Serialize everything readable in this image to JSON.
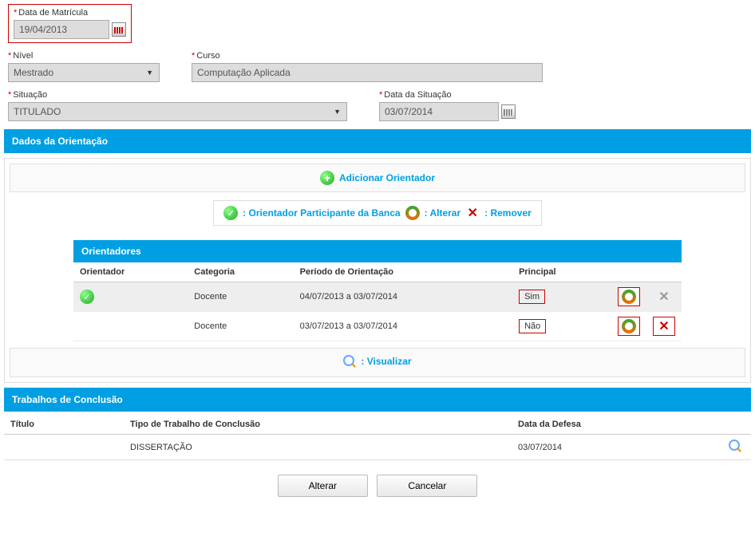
{
  "labels": {
    "matricula": "Data de Matrícula",
    "nivel": "Nível",
    "curso": "Curso",
    "situacao": "Situação",
    "data_situacao": "Data da Situação"
  },
  "values": {
    "matricula": "19/04/2013",
    "nivel": "Mestrado",
    "curso": "Computação Aplicada",
    "situacao": "TITULADO",
    "data_situacao": "03/07/2014"
  },
  "sections": {
    "orientacao": "Dados da Orientação",
    "orientadores": "Orientadores",
    "trabalhos": "Trabalhos de Conclusão"
  },
  "links": {
    "adicionar": "Adicionar Orientador",
    "visualizar": ": Visualizar"
  },
  "legend": {
    "participante": ": Orientador Participante da Banca",
    "alterar": ": Alterar",
    "remover": ": Remover"
  },
  "orientadores_table": {
    "headers": {
      "orientador": "Orientador",
      "categoria": "Categoria",
      "periodo": "Período de Orientação",
      "principal": "Principal"
    },
    "rows": [
      {
        "orientador": "",
        "check": true,
        "categoria": "Docente",
        "periodo": "04/07/2013 a 03/07/2014",
        "principal": "Sim",
        "remove_disabled": true
      },
      {
        "orientador": "",
        "check": false,
        "categoria": "Docente",
        "periodo": "03/07/2013 a 03/07/2014",
        "principal": "Não",
        "remove_disabled": false
      }
    ]
  },
  "trabalhos_table": {
    "headers": {
      "titulo": "Título",
      "tipo": "Tipo de Trabalho de Conclusão",
      "data": "Data da Defesa"
    },
    "rows": [
      {
        "titulo": "",
        "tipo": "DISSERTAÇÃO",
        "data": "03/07/2014"
      }
    ]
  },
  "buttons": {
    "alterar": "Alterar",
    "cancelar": "Cancelar"
  }
}
